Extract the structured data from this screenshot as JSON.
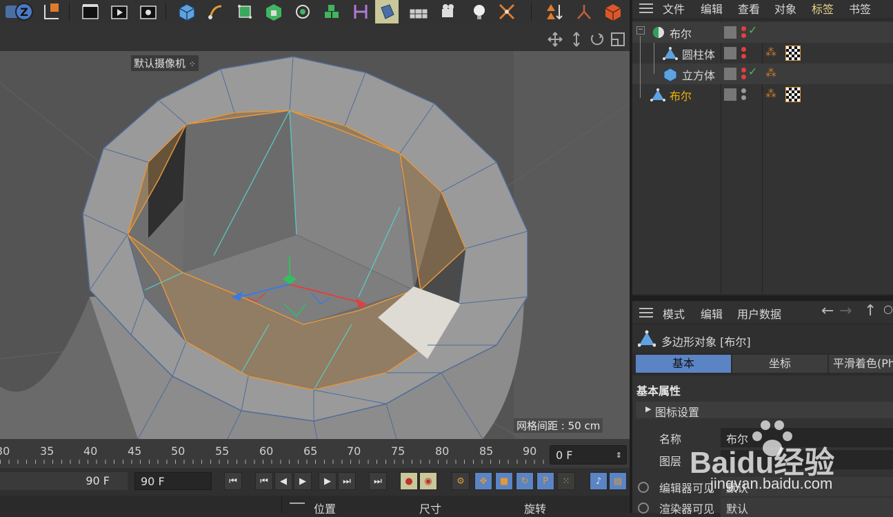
{
  "toolbar": {
    "icons": [
      "undo-icon",
      "redo-icon",
      "render-view-icon",
      "render-picture-icon",
      "render-settings-icon",
      "cube-icon",
      "pen-icon",
      "subdivision-icon",
      "extrude-icon",
      "cloner-icon",
      "mograph-icon",
      "deformer-icon",
      "bend-icon",
      "floor-icon",
      "camera-icon",
      "light-icon",
      "xpresso-icon",
      "constraint-icon",
      "joint-icon",
      "layer-icon"
    ]
  },
  "viewport": {
    "camera_label": "默认摄像机",
    "grid_spacing": "网格间距 : 50 cm"
  },
  "timeline": {
    "ticks": [
      "30",
      "35",
      "40",
      "45",
      "50",
      "55",
      "60",
      "65",
      "70",
      "75",
      "80",
      "85",
      "90"
    ],
    "current_frame": "0 F",
    "end_frame_left": "90 F",
    "end_frame_field": "90 F"
  },
  "bottom": {
    "position": "位置",
    "size": "尺寸",
    "rotation": "旋转"
  },
  "object_manager": {
    "menu": [
      "文件",
      "编辑",
      "查看",
      "对象",
      "标签",
      "书签"
    ],
    "objects": [
      {
        "name": "布尔",
        "color": "#d8d8d8"
      },
      {
        "name": "圆柱体",
        "color": "#d8d8d8"
      },
      {
        "name": "立方体",
        "color": "#d8d8d8"
      },
      {
        "name": "布尔",
        "color": "#f0b400"
      }
    ]
  },
  "attribute_manager": {
    "menu": [
      "模式",
      "编辑",
      "用户数据"
    ],
    "title": "多边形对象 [布尔]",
    "tabs": [
      "基本",
      "坐标",
      "平滑着色(Ph"
    ],
    "section": "基本属性",
    "subsection": "图标设置",
    "fields": [
      {
        "label": "名称",
        "value": "布尔"
      },
      {
        "label": "图层",
        "value": ""
      },
      {
        "label": "编辑器可见",
        "value": "默认"
      },
      {
        "label": "渲染器可见",
        "value": "默认"
      }
    ]
  },
  "watermark": {
    "brand": "Baidu经验",
    "url": "jingyan.baidu.com"
  },
  "colors": {
    "accent_blue": "#5b84c4",
    "selection_orange": "#e8973a",
    "active_yellow": "#f0b400"
  }
}
